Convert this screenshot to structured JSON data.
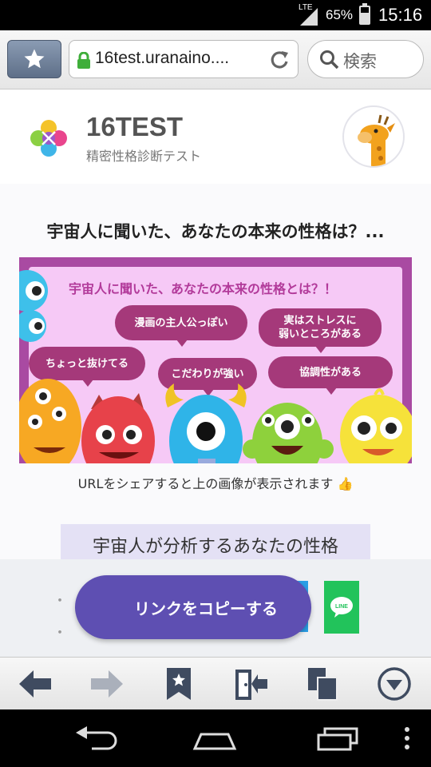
{
  "status_bar": {
    "network": "LTE",
    "battery": "65%",
    "time": "15:16"
  },
  "browser": {
    "url": "16test.uranaino....",
    "search_placeholder": "検索"
  },
  "site": {
    "brand": "16TEST",
    "tagline": "精密性格診断テスト"
  },
  "article": {
    "title": "宇宙人に聞いた、あなたの本来の性格は？...",
    "banner": {
      "title": "宇宙人に聞いた、あなたの本来の性格とは？！",
      "bubbles": [
        "漫画の主人公っぽい",
        "実はストレスに",
        "弱いところがある",
        "ちょっと抜けてる",
        "こだわりが強い",
        "協調性がある"
      ]
    },
    "share_note": "URLをシェアすると上の画像が表示されます",
    "section_heading": "宇宙人が分析するあなたの性格",
    "bullets": [
      "・",
      "・",
      "・"
    ]
  },
  "actions": {
    "copy_link": "リンクをコピーする",
    "line_label": "LINE"
  },
  "colors": {
    "copy_button": "#5e4fb2",
    "banner_frame": "#a94aa2",
    "banner_bg": "#f6c9f6",
    "bubble": "#a5397a",
    "line": "#22c35b"
  },
  "icons": {
    "bottom_bar": [
      "back-arrow-icon",
      "forward-arrow-icon",
      "bookmark-icon",
      "exit-icon",
      "tabs-icon",
      "menu-down-icon"
    ],
    "nav_bar": [
      "android-back-icon",
      "android-home-icon",
      "android-recents-icon",
      "android-overflow-icon"
    ]
  }
}
